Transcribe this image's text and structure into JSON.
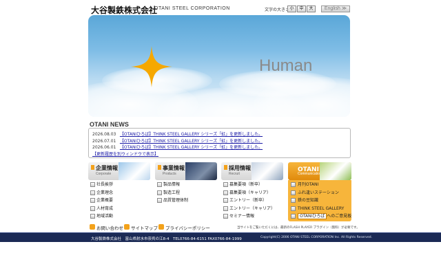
{
  "header": {
    "logo": "大谷製鉄株式会社",
    "corporation": "OTANI STEEL CORPORATION",
    "font_size_label": "文字の大きさ",
    "font_size_small": "小",
    "font_size_medium": "中",
    "font_size_large": "大",
    "english_button": "English ≫"
  },
  "hero": {
    "text": "Human"
  },
  "news": {
    "title": "OTANI NEWS",
    "items": [
      {
        "date": "2026.08.03",
        "text": "【OTANIひろば】THINK STEEL GALLERY シリーズ「虹」を更新しました。"
      },
      {
        "date": "2026.07.01",
        "text": "【OTANIひろば】THINK STEEL GALLERY シリーズ「虹」を更新しました。"
      },
      {
        "date": "2026.06.01",
        "text": "【OTANIひろば】THINK STEEL GALLERY シリーズ「虹」を更新しました。"
      }
    ],
    "more_link": "【更新履歴を別ウィンドウで表示】"
  },
  "panels": {
    "corporate": {
      "title": "企業情報",
      "subtitle": "Corporate",
      "items": [
        "社長挨拶",
        "企業理念",
        "企業概要",
        "人材育成",
        "地域活動"
      ]
    },
    "products": {
      "title": "事業情報",
      "subtitle": "Products",
      "items": [
        "製品情報",
        "製造工程",
        "品質管理体制"
      ]
    },
    "recruit": {
      "title": "採用情報",
      "subtitle": "Recruit",
      "items": [
        "募集要項（新卒）",
        "募集要項（キャリア）",
        "エントリー（新卒）",
        "エントリー（キャリア）",
        "セミナー情報"
      ]
    },
    "communication": {
      "title": "OTANIひろば",
      "subtitle": "Communication",
      "items": [
        "月刊OTANI",
        "ふれ逢いステーション",
        "鉄の豆知識",
        "THINK STEEL GALLERY"
      ],
      "highlight_item": "OTANIひろば",
      "highlight_suffix": "へのご意見板"
    }
  },
  "footer_links": {
    "contact": "お問い合わせ",
    "sitemap": "サイトマップ",
    "privacy": "プライバシーポリシー",
    "flash_note": "当サイトをご覧いただくには、最新のFLASH PLAYER プラグイン（無料）が必要です。"
  },
  "bottom_bar": {
    "company_info": "大谷製鉄株式会社　富山県射水市奈呉の江8-4　TEL0766-84-6151 FAX0766-84-1999",
    "copyright": "Copyright(C) 2006 OTANI STEEL CORPORATION Inc. All Rights Reserved."
  },
  "colors": {
    "accent_orange": "#f3a21b",
    "link_blue": "#1a1aa6",
    "footer_navy": "#1b2a55"
  }
}
